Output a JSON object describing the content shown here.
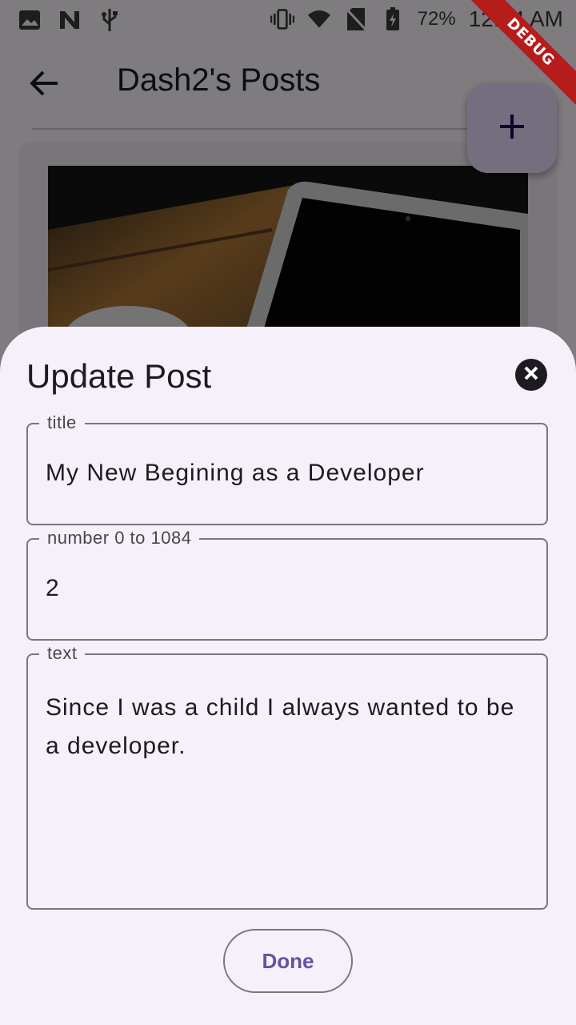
{
  "status_bar": {
    "battery_percent": "72%",
    "time": "12:14 AM",
    "icons": [
      "image-icon",
      "n-icon",
      "usb-icon",
      "vibrate-icon",
      "wifi-icon",
      "no-sim-icon",
      "battery-charging-icon"
    ]
  },
  "app_bar": {
    "title": "Dash2's Posts",
    "back_icon": "arrow-back-icon"
  },
  "fab": {
    "icon": "plus-icon"
  },
  "debug_banner": "DEBUG",
  "sheet": {
    "title": "Update Post",
    "close_icon": "close-circle-icon",
    "fields": {
      "title": {
        "label": "title",
        "value": "My New Begining as a Developer"
      },
      "number": {
        "label": "number 0 to 1084",
        "value": "2"
      },
      "text": {
        "label": "text",
        "value": "Since I was a child I always wanted to be a developer."
      }
    },
    "done_label": "Done"
  },
  "colors": {
    "accent": "#6750a4",
    "sheet_bg": "#f5f0fa",
    "fab_bg": "#eaddff",
    "debug_red": "#b71c1c"
  }
}
